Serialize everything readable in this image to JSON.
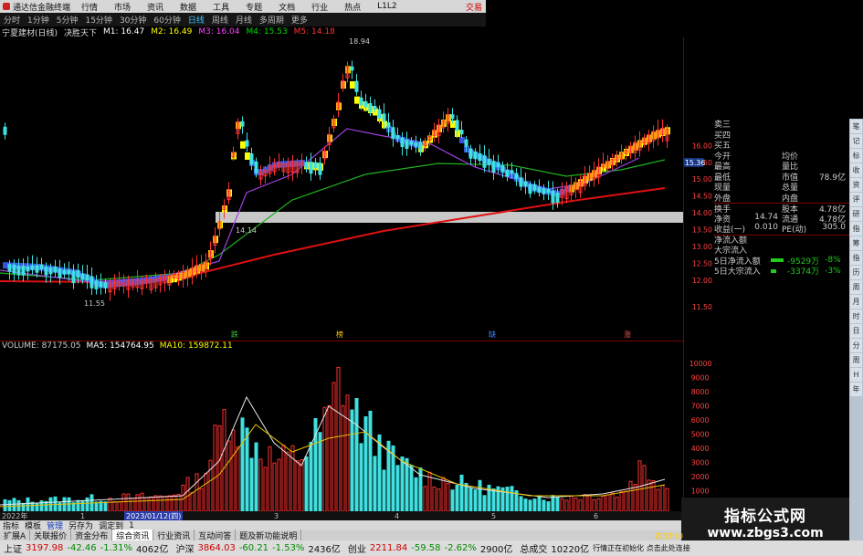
{
  "window": {
    "app_title": "通达信金融终端",
    "menus": [
      "行情",
      "市场",
      "资讯",
      "数据",
      "工具",
      "专题",
      "文档",
      "行业",
      "热点",
      "L1L2"
    ],
    "trade_label": "交易"
  },
  "toolbar": {
    "periods": [
      "分时",
      "1分钟",
      "5分钟",
      "15分钟",
      "30分钟",
      "60分钟",
      "日线",
      "周线",
      "月线",
      "多周期",
      "更多"
    ],
    "active_period": "日线"
  },
  "chart_header": {
    "stock": "宁夏建材(日线)",
    "indicator": "决胜天下",
    "ma": [
      {
        "label": "M1: 16.47",
        "color": "#ffffff"
      },
      {
        "label": "M2: 16.49",
        "color": "#ffff00"
      },
      {
        "label": "M3: 16.04",
        "color": "#ff44ff"
      },
      {
        "label": "M4: 15.53",
        "color": "#00dd00"
      },
      {
        "label": "M5: 14.18",
        "color": "#ff3030"
      }
    ]
  },
  "price_axis": {
    "labels": [
      "16.00",
      "15.50",
      "15.00",
      "14.50",
      "14.00",
      "13.50",
      "13.00",
      "12.50",
      "12.00",
      "11.50"
    ],
    "current_price": "15.36"
  },
  "annotations": {
    "high": "18.94",
    "support": "14.14",
    "low": "11.55",
    "event_marks": [
      "跌",
      "榜",
      "缺",
      "涨"
    ]
  },
  "volume": {
    "header": {
      "volume": "VOLUME: 87175.05",
      "ma5": "MA5: 154764.95",
      "ma10": "MA10: 159872.11"
    },
    "axis_labels": [
      "10000",
      "9000",
      "8000",
      "7000",
      "6000",
      "5000",
      "4000",
      "3000",
      "2000",
      "1000"
    ]
  },
  "timeline": {
    "labels": [
      "2022年",
      "1",
      "2023/01/12(四)",
      "3",
      "4",
      "5",
      "6"
    ],
    "selected": "2023/01/12(四)"
  },
  "quote_panel": {
    "top_rows": [
      "卖三",
      "买四",
      "买五"
    ],
    "rows": [
      [
        "今开",
        "",
        "均价",
        ""
      ],
      [
        "最高",
        "",
        "量比",
        ""
      ],
      [
        "最低",
        "",
        "市值",
        "78.9亿"
      ],
      [
        "现量",
        "",
        "总量",
        ""
      ],
      [
        "外盘",
        "",
        "内盘",
        ""
      ],
      [
        "换手",
        "",
        "股本",
        "4.78亿"
      ],
      [
        "净资",
        "14.74",
        "流通",
        "4.78亿"
      ],
      [
        "收益(一)",
        "0.010",
        "PE(动)",
        "305.0"
      ]
    ],
    "flow": [
      {
        "label": "净流入额",
        "value": "",
        "pct": ""
      },
      {
        "label": "大宗流入",
        "value": "",
        "pct": ""
      },
      {
        "label": "5日净流入额",
        "value": "-9529万",
        "pct": "-8%"
      },
      {
        "label": "5日大宗流入",
        "value": "-3374万",
        "pct": "-3%"
      }
    ]
  },
  "right_tabs": [
    "笔",
    "记",
    "标",
    "收",
    "资",
    "评",
    "研",
    "指",
    "筹",
    "指",
    "历",
    "周",
    "月",
    "时",
    "日",
    "分",
    "周",
    "H",
    "年"
  ],
  "func_tabs": [
    "指标",
    "模板",
    "管理",
    "另存为",
    "调定到",
    "1"
  ],
  "sub_tabs": [
    "扩展A",
    "关联报价",
    "资金分布",
    "综合资讯",
    "行业资讯",
    "互动问答",
    "题及新功能说明"
  ],
  "sub_tab_active": "综合资讯",
  "statusbar": {
    "sh_name": "上证",
    "sh_index": "3197.98",
    "sh_chg": "-42.46",
    "sh_pct": "-1.31%",
    "sh_amt": "4062亿",
    "sz_name": "沪深",
    "sz_index": "3864.03",
    "sz_chg": "-60.21",
    "sz_pct": "-1.53%",
    "sz_amt": "2436亿",
    "cy_name": "创业",
    "cy_index": "2211.84",
    "cy_chg": "-59.58",
    "cy_pct": "-2.62%",
    "cy_amt": "2900亿",
    "total_label": "总成交",
    "total_amt": "10220亿",
    "notice": "行情正在初始化 点击此处连接"
  },
  "bottom_right_label": "四文F10",
  "watermark": {
    "line1": "指标公式网",
    "line2": "www.zbgs3.com"
  },
  "colors": {
    "up": "#ff3030",
    "down": "#40e0e0",
    "bull_band": "#ffff00",
    "bear_band": "#4060ff",
    "grid": "#7a0000"
  }
}
